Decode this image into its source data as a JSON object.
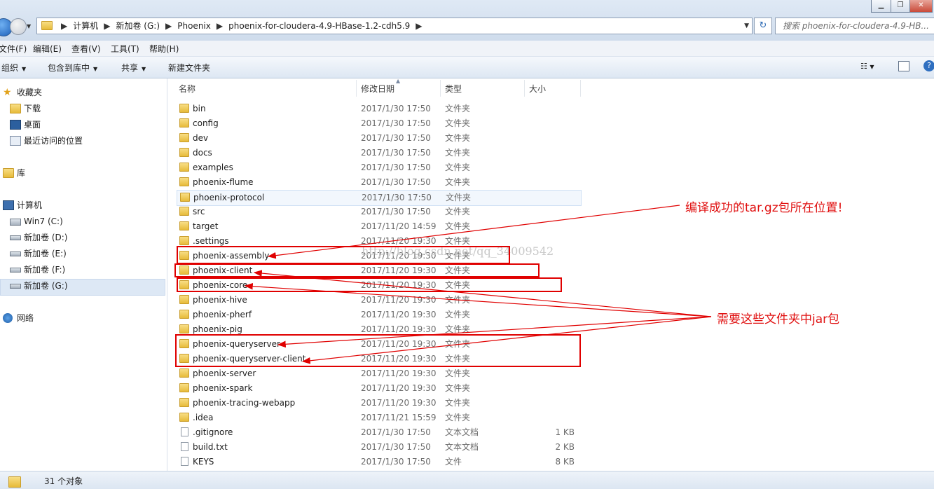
{
  "breadcrumbs": [
    "计算机",
    "新加卷 (G:)",
    "Phoenix",
    "phoenix-for-cloudera-4.9-HBase-1.2-cdh5.9"
  ],
  "search_placeholder": "搜索 phoenix-for-cloudera-4.9-HB...",
  "menu": [
    "文件(F)",
    "编辑(E)",
    "查看(V)",
    "工具(T)",
    "帮助(H)"
  ],
  "toolbar": {
    "organize": "组织",
    "include": "包含到库中",
    "share": "共享",
    "new_folder": "新建文件夹"
  },
  "nav": {
    "favorites": "收藏夹",
    "downloads": "下载",
    "desktop": "桌面",
    "recent": "最近访问的位置",
    "libraries": "库",
    "computer": "计算机",
    "c": "Win7 (C:)",
    "d": "新加卷 (D:)",
    "e": "新加卷 (E:)",
    "f": "新加卷 (F:)",
    "g": "新加卷 (G:)",
    "network": "网络"
  },
  "columns": {
    "name": "名称",
    "date": "修改日期",
    "type": "类型",
    "size": "大小"
  },
  "files": [
    {
      "name": "bin",
      "date": "2017/1/30 17:50",
      "type": "文件夹",
      "size": "",
      "kind": "folder"
    },
    {
      "name": "config",
      "date": "2017/1/30 17:50",
      "type": "文件夹",
      "size": "",
      "kind": "folder"
    },
    {
      "name": "dev",
      "date": "2017/1/30 17:50",
      "type": "文件夹",
      "size": "",
      "kind": "folder"
    },
    {
      "name": "docs",
      "date": "2017/1/30 17:50",
      "type": "文件夹",
      "size": "",
      "kind": "folder"
    },
    {
      "name": "examples",
      "date": "2017/1/30 17:50",
      "type": "文件夹",
      "size": "",
      "kind": "folder"
    },
    {
      "name": "phoenix-flume",
      "date": "2017/1/30 17:50",
      "type": "文件夹",
      "size": "",
      "kind": "folder"
    },
    {
      "name": "phoenix-protocol",
      "date": "2017/1/30 17:50",
      "type": "文件夹",
      "size": "",
      "kind": "folder"
    },
    {
      "name": "src",
      "date": "2017/1/30 17:50",
      "type": "文件夹",
      "size": "",
      "kind": "folder"
    },
    {
      "name": "target",
      "date": "2017/11/20 14:59",
      "type": "文件夹",
      "size": "",
      "kind": "folder"
    },
    {
      "name": ".settings",
      "date": "2017/11/20 19:30",
      "type": "文件夹",
      "size": "",
      "kind": "folder"
    },
    {
      "name": "phoenix-assembly",
      "date": "2017/11/20 19:30",
      "type": "文件夹",
      "size": "",
      "kind": "folder"
    },
    {
      "name": "phoenix-client",
      "date": "2017/11/20 19:30",
      "type": "文件夹",
      "size": "",
      "kind": "folder"
    },
    {
      "name": "phoenix-core",
      "date": "2017/11/20 19:30",
      "type": "文件夹",
      "size": "",
      "kind": "folder"
    },
    {
      "name": "phoenix-hive",
      "date": "2017/11/20 19:30",
      "type": "文件夹",
      "size": "",
      "kind": "folder"
    },
    {
      "name": "phoenix-pherf",
      "date": "2017/11/20 19:30",
      "type": "文件夹",
      "size": "",
      "kind": "folder"
    },
    {
      "name": "phoenix-pig",
      "date": "2017/11/20 19:30",
      "type": "文件夹",
      "size": "",
      "kind": "folder"
    },
    {
      "name": "phoenix-queryserver",
      "date": "2017/11/20 19:30",
      "type": "文件夹",
      "size": "",
      "kind": "folder"
    },
    {
      "name": "phoenix-queryserver-client",
      "date": "2017/11/20 19:30",
      "type": "文件夹",
      "size": "",
      "kind": "folder"
    },
    {
      "name": "phoenix-server",
      "date": "2017/11/20 19:30",
      "type": "文件夹",
      "size": "",
      "kind": "folder"
    },
    {
      "name": "phoenix-spark",
      "date": "2017/11/20 19:30",
      "type": "文件夹",
      "size": "",
      "kind": "folder"
    },
    {
      "name": "phoenix-tracing-webapp",
      "date": "2017/11/20 19:30",
      "type": "文件夹",
      "size": "",
      "kind": "folder"
    },
    {
      "name": ".idea",
      "date": "2017/11/21 15:59",
      "type": "文件夹",
      "size": "",
      "kind": "folder"
    },
    {
      "name": ".gitignore",
      "date": "2017/1/30 17:50",
      "type": "文本文档",
      "size": "1 KB",
      "kind": "doc"
    },
    {
      "name": "build.txt",
      "date": "2017/1/30 17:50",
      "type": "文本文档",
      "size": "2 KB",
      "kind": "doc"
    },
    {
      "name": "KEYS",
      "date": "2017/1/30 17:50",
      "type": "文件",
      "size": "8 KB",
      "kind": "doc"
    }
  ],
  "annotations": {
    "tar_location": "编译成功的tar.gz包所在位置!",
    "need_jars": "需要这些文件夹中jar包",
    "watermark": "http://blog.csdn.net/qq_34009542"
  },
  "status": "31 个对象",
  "annotation_color": "#e00000"
}
